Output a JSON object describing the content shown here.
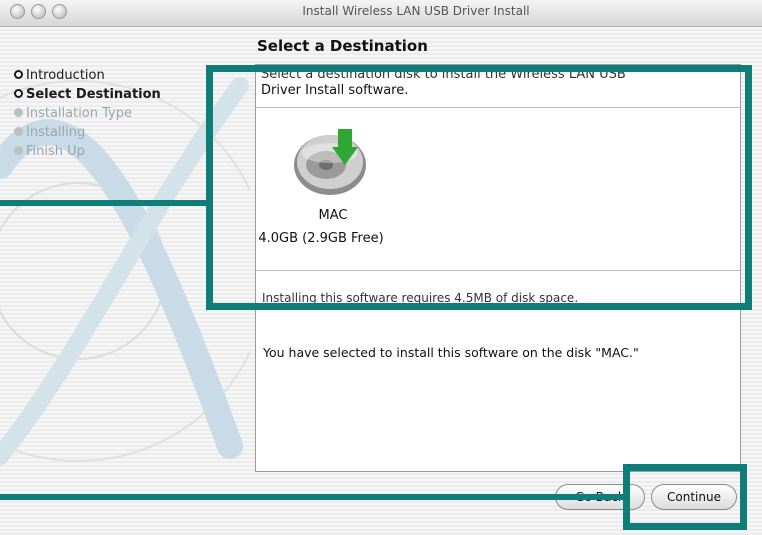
{
  "window": {
    "title": "Install Wireless LAN USB Driver Install"
  },
  "page": {
    "heading": "Select a Destination"
  },
  "steps": [
    {
      "label": "Introduction",
      "state": "done"
    },
    {
      "label": "Select Destination",
      "state": "current"
    },
    {
      "label": "Installation Type",
      "state": "pending"
    },
    {
      "label": "Installing",
      "state": "pending"
    },
    {
      "label": "Finish Up",
      "state": "pending"
    }
  ],
  "panel": {
    "description_line1": "Select a destination disk to install the Wireless LAN USB",
    "description_line2": "Driver Install software.",
    "disk": {
      "name": "MAC",
      "size": "4.0GB (2.9GB Free)",
      "icon": "hard-disk-install-icon"
    },
    "requirement": "Installing this software requires 4.5MB of disk space.",
    "selected_message": "You have selected to install this software on the disk \"MAC.\""
  },
  "buttons": {
    "back": "Go Back",
    "continue": "Continue"
  },
  "annotation_color": "#0f7d78"
}
